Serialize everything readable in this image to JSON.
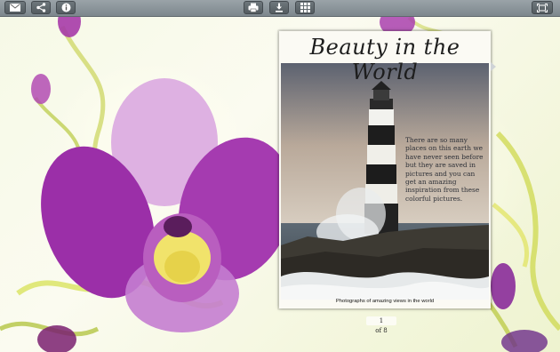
{
  "toolbar": {
    "left_buttons": [
      {
        "icon": "mail-icon"
      },
      {
        "icon": "share-icon"
      },
      {
        "icon": "info-icon"
      }
    ],
    "center_buttons": [
      {
        "icon": "print-icon"
      },
      {
        "icon": "download-icon"
      },
      {
        "icon": "thumbnails-grid-icon"
      }
    ],
    "right_buttons": [
      {
        "icon": "fullscreen-icon"
      }
    ]
  },
  "book": {
    "title": "Beauty in the World",
    "body_text": "There are so many places on this earth we have never seen before but they are saved in pictures and you can get an amazing inspiration from these colorful pictures.",
    "caption": "Photographs of amazing views in the world"
  },
  "pager": {
    "current": "1",
    "total": "of 8"
  },
  "colors": {
    "toolbar": "#8a9499",
    "orchid": "#9b2fa8",
    "orchid_center": "#f2e36a",
    "stem": "#c8d83a"
  }
}
